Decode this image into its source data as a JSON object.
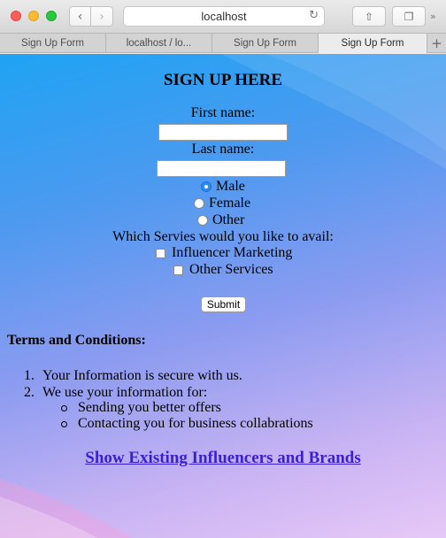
{
  "browser": {
    "url": "localhost",
    "tabs": [
      {
        "label": "Sign Up Form",
        "active": false
      },
      {
        "label": "localhost / lo...",
        "active": false
      },
      {
        "label": "Sign Up Form",
        "active": false
      },
      {
        "label": "Sign Up Form",
        "active": true
      }
    ],
    "back_icon": "‹",
    "forward_icon": "›",
    "reload_icon": "↻",
    "share_icon": "⇧",
    "tabs_icon": "❐",
    "more_icon": "»",
    "newtab_icon": "+"
  },
  "page": {
    "heading": "SIGN UP HERE",
    "first_name_label": "First name:",
    "first_name_value": "",
    "last_name_label": "Last name:",
    "last_name_value": "",
    "gender": {
      "options": [
        "Male",
        "Female",
        "Other"
      ],
      "selected": "Male"
    },
    "services_label": "Which Servies would you like to avail:",
    "services": [
      "Influencer Marketing",
      "Other Services"
    ],
    "submit_label": "Submit",
    "terms_title": "Terms and Conditions:",
    "terms": [
      {
        "num": "1.",
        "text": "Your Information is secure with us."
      },
      {
        "num": "2.",
        "text": "We use your information for:"
      }
    ],
    "uses": [
      "Sending you better offers",
      "Contacting you for business collabrations"
    ],
    "show_link": "Show Existing Influencers and Brands"
  },
  "colors": {
    "accent_radio": "#2f8af5",
    "link": "#3a1fd0",
    "bg_top": "#1fa3f3",
    "bg_bottom": "#e7c8f7"
  }
}
